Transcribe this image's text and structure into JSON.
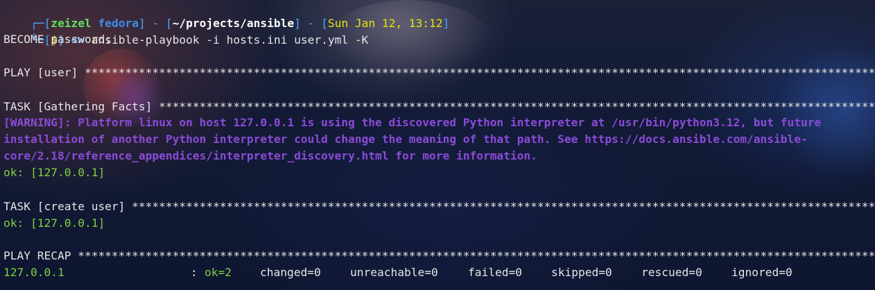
{
  "prompt": {
    "box_top": "┌─[",
    "user": "zeizel",
    "host": "fedora",
    "sep": "] - [",
    "path": "~/projects/ansible",
    "sep2": "] - [",
    "datetime": "Sun Jan 12, 13:12",
    "close": "]",
    "box_bottom": "└─[",
    "symbol": "$",
    "close2": "]",
    "arrow": "<>",
    "command": "ansible-playbook -i hosts.ini user.yml -K"
  },
  "output": {
    "become": "BECOME password:",
    "play_user": "PLAY [user] ************************************************************************************************************************************",
    "task_facts": "TASK [Gathering Facts] *********************************************************************************************************************",
    "warning_1": "[WARNING]: Platform linux on host 127.0.0.1 is using the discovered Python interpreter at /usr/bin/python3.12, but future",
    "warning_2": "installation of another Python interpreter could change the meaning of that path. See https://docs.ansible.com/ansible-",
    "warning_3": "core/2.18/reference_appendices/interpreter_discovery.html for more information.",
    "ok_1": "ok: [127.0.0.1]",
    "task_create": "TASK [create user] *************************************************************************************************************************",
    "ok_2": "ok: [127.0.0.1]",
    "play_recap": "PLAY RECAP *************************************************************************************************************************************",
    "recap": {
      "host": "127.0.0.1",
      "colon": ":",
      "ok": "ok=2",
      "changed": "changed=0",
      "unreachable": "unreachable=0",
      "failed": "failed=0",
      "skipped": "skipped=0",
      "rescued": "rescued=0",
      "ignored": "ignored=0"
    }
  },
  "colors": {
    "prompt_frame": "#4aa8ff",
    "user": "#5fe05f",
    "host": "#3b8eea",
    "path": "#ffffff",
    "datetime": "#e5e510",
    "warning": "#8b4bd8",
    "ok": "#7fd141"
  }
}
